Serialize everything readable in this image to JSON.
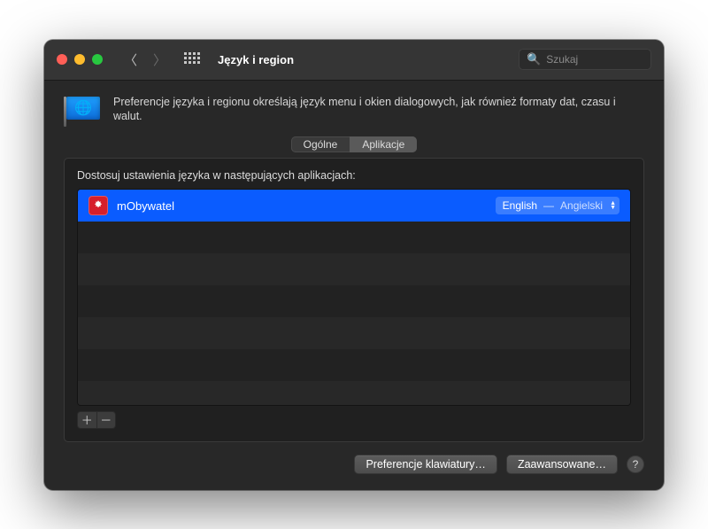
{
  "window": {
    "title": "Język i region"
  },
  "search": {
    "placeholder": "Szukaj"
  },
  "header": {
    "description": "Preferencje języka i regionu określają język menu i okien dialogowych, jak również formaty dat, czasu i walut."
  },
  "tabs": {
    "general": "Ogólne",
    "apps": "Aplikacje",
    "active": "apps"
  },
  "panel": {
    "label": "Dostosuj ustawienia języka w następujących aplikacjach:"
  },
  "apps": [
    {
      "name": "mObywatel",
      "icon_glyph": "♞",
      "language_primary": "English",
      "language_secondary": "Angielski"
    }
  ],
  "footer": {
    "keyboard_prefs": "Preferencje klawiatury…",
    "advanced": "Zaawansowane…"
  },
  "glyphs": {
    "add": "＋",
    "remove": "－",
    "help": "?",
    "search": "⌕"
  }
}
